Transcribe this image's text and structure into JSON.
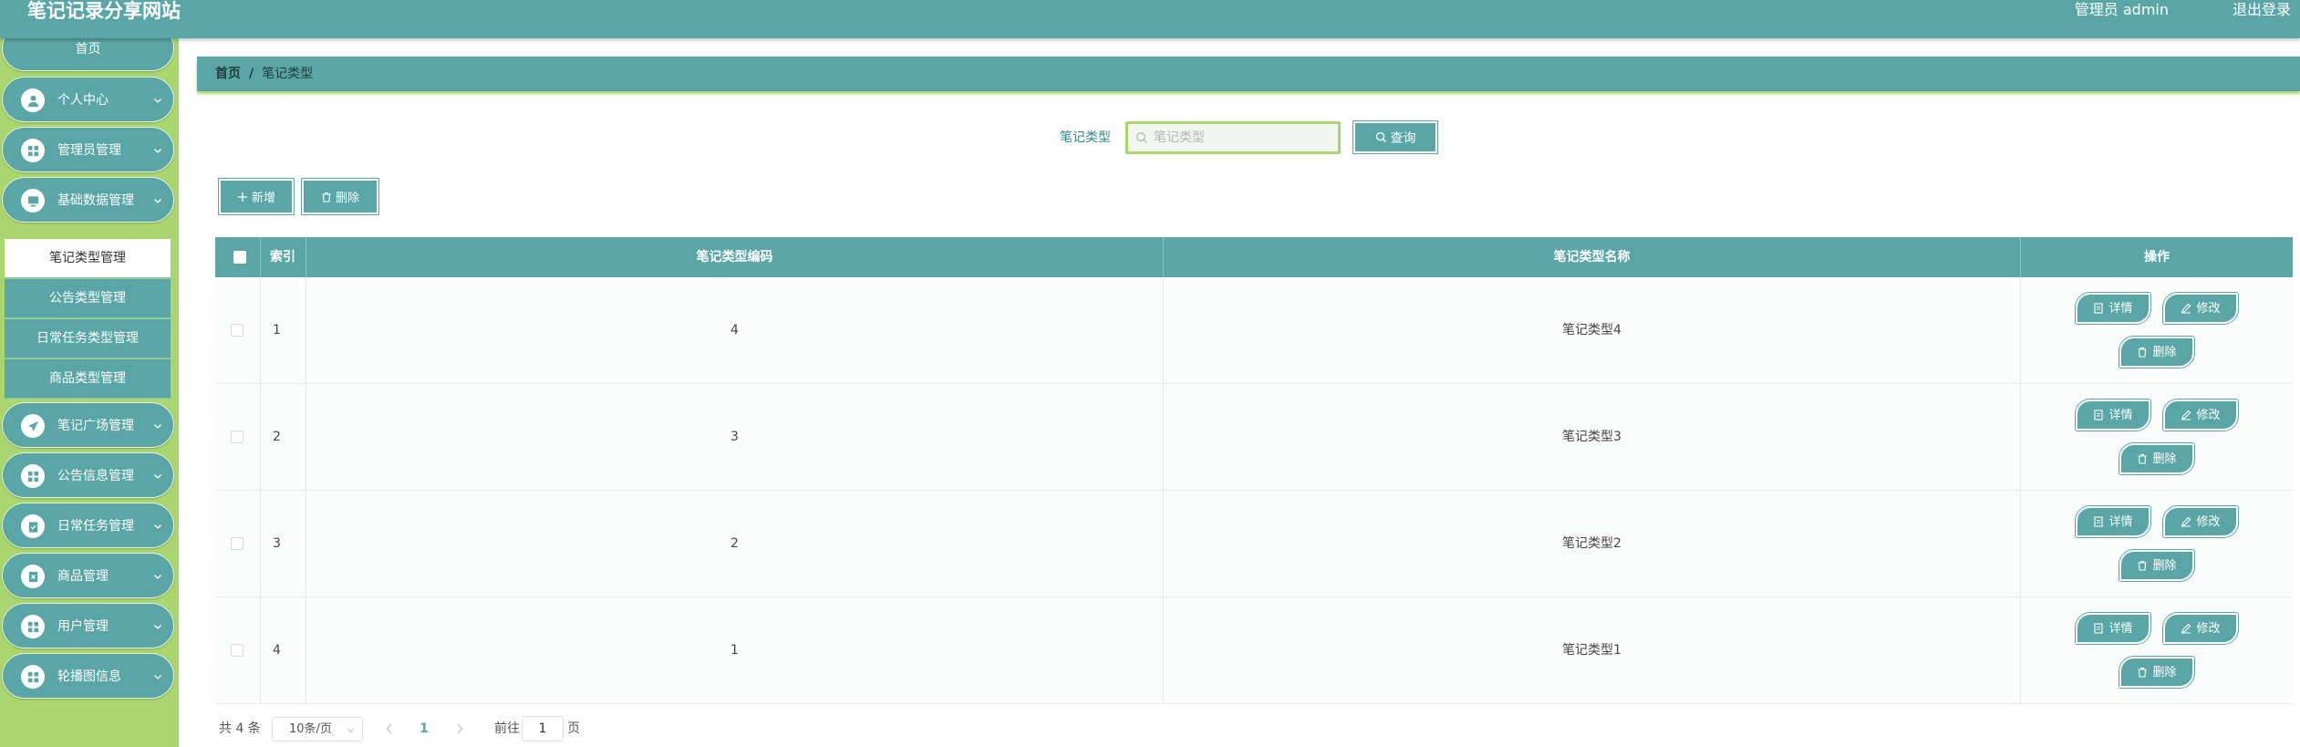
{
  "header": {
    "title": "笔记记录分享网站",
    "user_label": "管理员 admin",
    "logout": "退出登录"
  },
  "sidebar": {
    "home": "首页",
    "items": [
      {
        "label": "个人中心",
        "icon": "person-icon"
      },
      {
        "label": "管理员管理",
        "icon": "grid-icon"
      },
      {
        "label": "基础数据管理",
        "icon": "monitor-icon"
      },
      {
        "label": "笔记广场管理",
        "icon": "paper-plane-icon"
      },
      {
        "label": "公告信息管理",
        "icon": "grid-icon"
      },
      {
        "label": "日常任务管理",
        "icon": "clipboard-check-icon"
      },
      {
        "label": "商品管理",
        "icon": "box-x-icon"
      },
      {
        "label": "用户管理",
        "icon": "grid-icon"
      },
      {
        "label": "轮播图信息",
        "icon": "grid-icon"
      }
    ],
    "subitems": [
      "笔记类型管理",
      "公告类型管理",
      "日常任务类型管理",
      "商品类型管理"
    ]
  },
  "breadcrumb": {
    "home": "首页",
    "separator": "/",
    "current": "笔记类型"
  },
  "search": {
    "label": "笔记类型",
    "placeholder": "笔记类型",
    "value": "",
    "button": "查询"
  },
  "toolbar": {
    "add": "新增",
    "delete": "删除"
  },
  "table": {
    "columns": [
      "索引",
      "笔记类型编码",
      "笔记类型名称",
      "操作"
    ],
    "rows": [
      {
        "index": "1",
        "code": "4",
        "name": "笔记类型4"
      },
      {
        "index": "2",
        "code": "3",
        "name": "笔记类型3"
      },
      {
        "index": "3",
        "code": "2",
        "name": "笔记类型2"
      },
      {
        "index": "4",
        "code": "1",
        "name": "笔记类型1"
      }
    ],
    "actions": {
      "detail": "详情",
      "edit": "修改",
      "delete": "删除"
    }
  },
  "pagination": {
    "total": "共 4 条",
    "page_size": "10条/页",
    "current_page": "1",
    "goto_label": "前往",
    "goto_value": "1",
    "page_unit": "页"
  },
  "colors": {
    "primary": "#5aa6a6",
    "sidebar_bg": "#a9d66e",
    "white": "#ffffff"
  }
}
